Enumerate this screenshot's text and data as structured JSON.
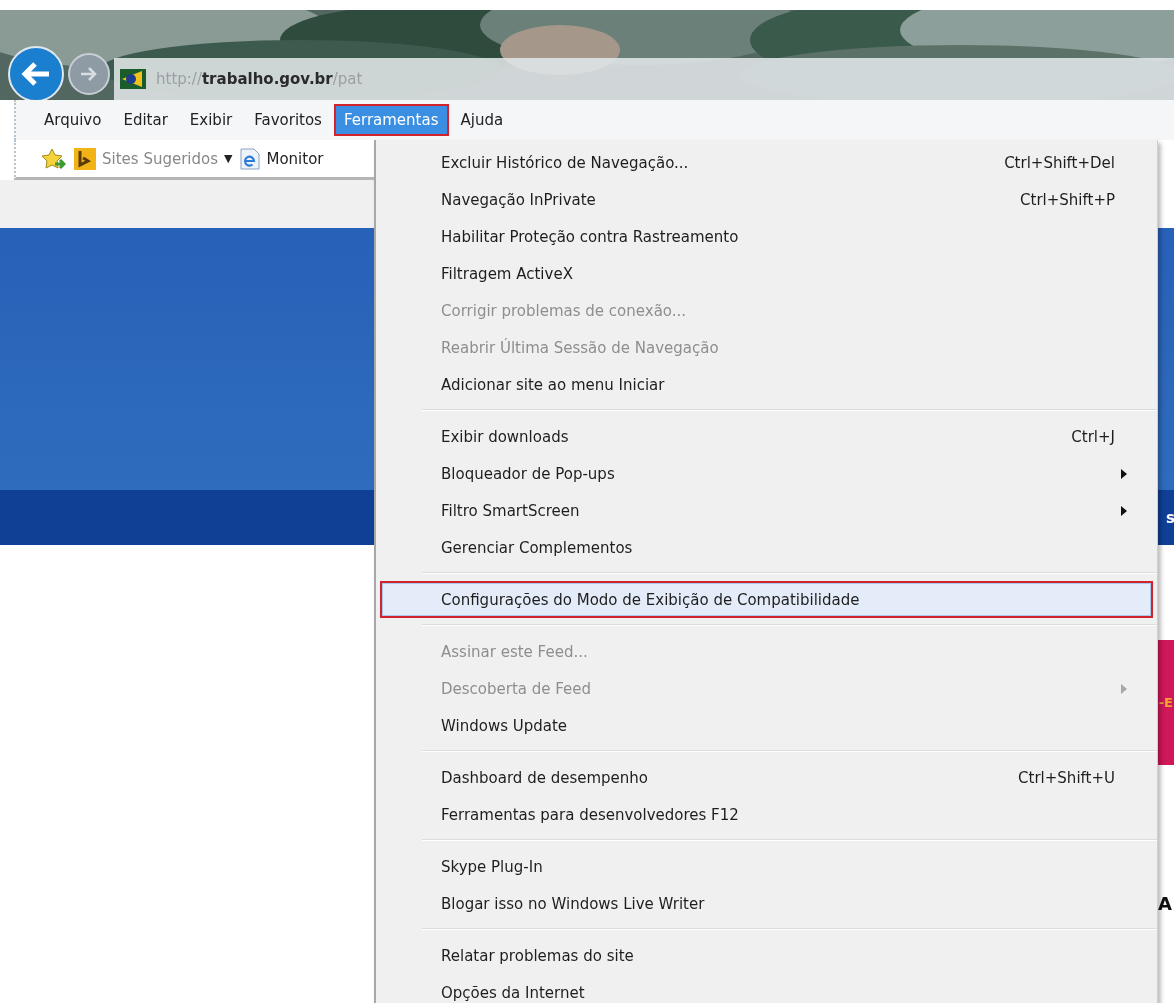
{
  "browser": {
    "address": "http://**trabalho.gov.br**/pat"
  },
  "menu_bar": [
    {
      "label": "Arquivo",
      "selected": false,
      "outlined": false
    },
    {
      "label": "Editar",
      "selected": false,
      "outlined": false
    },
    {
      "label": "Exibir",
      "selected": false,
      "outlined": false
    },
    {
      "label": "Favoritos",
      "selected": false,
      "outlined": false
    },
    {
      "label": "Ferramentas",
      "selected": true,
      "outlined": true
    },
    {
      "label": "Ajuda",
      "selected": false,
      "outlined": false
    }
  ],
  "favorites_bar": [
    {
      "kind": "bing",
      "label": "Sites Sugeridos",
      "caret": "▼"
    },
    {
      "kind": "ie",
      "label": "Monitor"
    }
  ],
  "page": {
    "band_text": "s",
    "banner_text": "-E",
    "heading_text": "A"
  },
  "tools_menu": [
    [
      {
        "label": "Excluir Histórico de Navegação...",
        "shortcut": "Ctrl+Shift+Del",
        "disabled": false,
        "submenu": false,
        "selected": false,
        "outlined": false
      },
      {
        "label": "Navegação InPrivate",
        "shortcut": "Ctrl+Shift+P",
        "disabled": false,
        "submenu": false,
        "selected": false,
        "outlined": false
      },
      {
        "label": "Habilitar Proteção contra Rastreamento",
        "disabled": false,
        "submenu": false,
        "selected": false,
        "outlined": false
      },
      {
        "label": "Filtragem ActiveX",
        "disabled": false,
        "submenu": false,
        "selected": false,
        "outlined": false
      },
      {
        "label": "Corrigir problemas de conexão...",
        "disabled": true,
        "submenu": false,
        "selected": false,
        "outlined": false
      },
      {
        "label": "Reabrir Última Sessão de Navegação",
        "disabled": true,
        "submenu": false,
        "selected": false,
        "outlined": false
      },
      {
        "label": "Adicionar site ao menu Iniciar",
        "disabled": false,
        "submenu": false,
        "selected": false,
        "outlined": false
      }
    ],
    [
      {
        "label": "Exibir downloads",
        "shortcut": "Ctrl+J",
        "disabled": false,
        "submenu": false,
        "selected": false,
        "outlined": false
      },
      {
        "label": "Bloqueador de Pop-ups",
        "disabled": false,
        "submenu": true,
        "selected": false,
        "outlined": false
      },
      {
        "label": "Filtro SmartScreen",
        "disabled": false,
        "submenu": true,
        "selected": false,
        "outlined": false
      },
      {
        "label": "Gerenciar Complementos",
        "disabled": false,
        "submenu": false,
        "selected": false,
        "outlined": false
      }
    ],
    [
      {
        "label": "Configurações do Modo de Exibição de Compatibilidade",
        "disabled": false,
        "submenu": false,
        "selected": true,
        "outlined": true
      }
    ],
    [
      {
        "label": "Assinar este Feed...",
        "disabled": true,
        "submenu": false,
        "selected": false,
        "outlined": false
      },
      {
        "label": "Descoberta de Feed",
        "disabled": true,
        "submenu": true,
        "selected": false,
        "outlined": false
      },
      {
        "label": "Windows Update",
        "disabled": false,
        "submenu": false,
        "selected": false,
        "outlined": false
      }
    ],
    [
      {
        "label": "Dashboard de desempenho",
        "shortcut": "Ctrl+Shift+U",
        "disabled": false,
        "submenu": false,
        "selected": false,
        "outlined": false
      },
      {
        "label": "Ferramentas para desenvolvedores F12",
        "disabled": false,
        "submenu": false,
        "selected": false,
        "outlined": false
      }
    ],
    [
      {
        "label": "Skype Plug-In",
        "disabled": false,
        "submenu": false,
        "selected": false,
        "outlined": false
      },
      {
        "label": "Blogar isso no Windows Live Writer",
        "disabled": false,
        "submenu": false,
        "selected": false,
        "outlined": false
      }
    ],
    [
      {
        "label": "Relatar problemas do site",
        "disabled": false,
        "submenu": false,
        "selected": false,
        "outlined": false
      },
      {
        "label": "Opções da Internet",
        "disabled": false,
        "submenu": false,
        "selected": false,
        "outlined": false
      }
    ]
  ]
}
